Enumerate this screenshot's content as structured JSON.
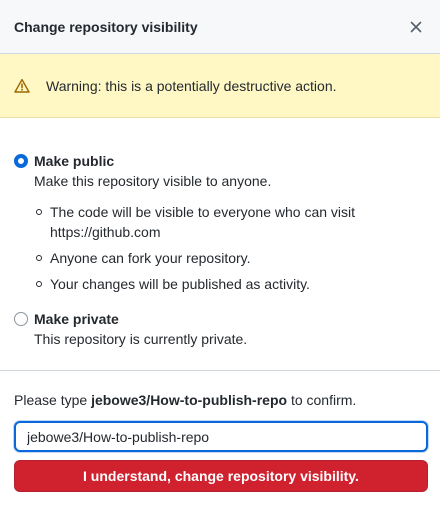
{
  "dialog": {
    "title": "Change repository visibility",
    "close_icon": "close-icon"
  },
  "warning": {
    "icon": "alert-triangle-icon",
    "text": "Warning: this is a potentially destructive action."
  },
  "options": {
    "public": {
      "title": "Make public",
      "description": "Make this repository visible to anyone.",
      "selected": true,
      "bullets": [
        "The code will be visible to everyone who can visit https://github.com",
        "Anyone can fork your repository.",
        "Your changes will be published as activity."
      ]
    },
    "private": {
      "title": "Make private",
      "description": "This repository is currently private.",
      "selected": false
    }
  },
  "confirm": {
    "prefix": "Please type ",
    "repo": "jebowe3/How-to-publish-repo",
    "suffix": " to confirm.",
    "input_value": "jebowe3/How-to-publish-repo",
    "button_label": "I understand, change repository visibility."
  },
  "colors": {
    "accent": "#0969da",
    "danger": "#cf222e",
    "warning_bg": "#fff8c5",
    "warning_icon": "#9a6700"
  }
}
